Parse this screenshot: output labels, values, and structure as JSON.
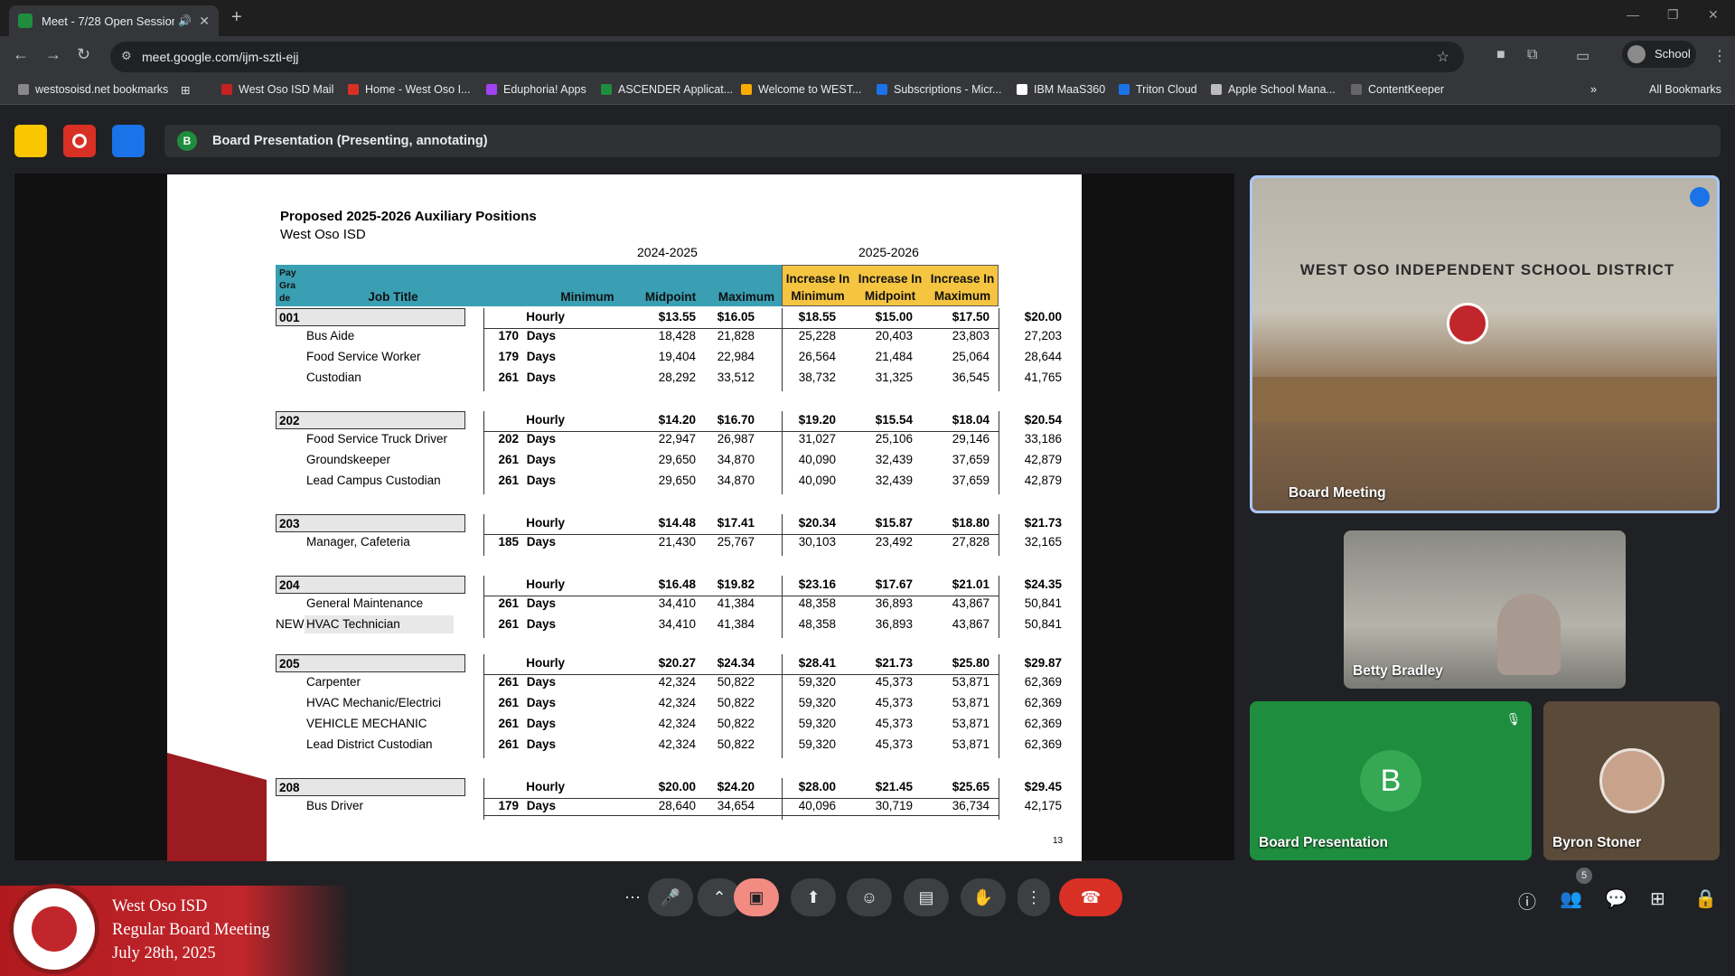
{
  "browser": {
    "tab_title": "Meet - 7/28 Open Session I",
    "url": "meet.google.com/ijm-szti-ejj",
    "profile": "School",
    "bookmarks": [
      "westosoisd.net bookmarks",
      "West Oso ISD Mail",
      "Home - West Oso I...",
      "Eduphoria! Apps",
      "ASCENDER Applicat...",
      "Welcome to WEST...",
      "Subscriptions - Micr...",
      "IBM MaaS360",
      "Triton Cloud",
      "Apple School Mana...",
      "ContentKeeper"
    ],
    "all_bookmarks": "All Bookmarks"
  },
  "meet": {
    "banner_initial": "B",
    "banner_text": "Board Presentation (Presenting, annotating)",
    "participants": [
      {
        "name": "Board Meeting"
      },
      {
        "name": "Betty Bradley"
      },
      {
        "name": "Board Presentation",
        "initial": "B"
      },
      {
        "name": "Byron Stoner"
      }
    ],
    "people_count": "5",
    "room_sign": "WEST OSO INDEPENDENT SCHOOL DISTRICT"
  },
  "slide": {
    "title": "Proposed 2025-2026 Auxiliary Positions",
    "subtitle": "West Oso ISD",
    "year_a": "2024-2025",
    "year_b": "2025-2026",
    "headers": {
      "pay_grade": "Pay\nGra\nde",
      "job_title": "Job Title",
      "min": "Minimum",
      "mid": "Midpoint",
      "max": "Maximum",
      "inc_min": "Increase In\nMinimum",
      "inc_mid": "Increase In\nMidpoint",
      "inc_max": "Increase In\nMaximum"
    },
    "page_number": "13",
    "groups": [
      {
        "grade": "001",
        "hourly": [
          "Hourly",
          "$13.55",
          "$16.05",
          "$18.55",
          "$15.00",
          "$17.50",
          "$20.00"
        ],
        "rows": [
          {
            "prefix": "",
            "title": "Bus Aide",
            "days": "170",
            "unit": "Days",
            "vals": [
              "18,428",
              "21,828",
              "25,228",
              "20,403",
              "23,803",
              "27,203"
            ]
          },
          {
            "prefix": "",
            "title": "Food Service Worker",
            "days": "179",
            "unit": "Days",
            "vals": [
              "19,404",
              "22,984",
              "26,564",
              "21,484",
              "25,064",
              "28,644"
            ]
          },
          {
            "prefix": "",
            "title": "Custodian",
            "days": "261",
            "unit": "Days",
            "vals": [
              "28,292",
              "33,512",
              "38,732",
              "31,325",
              "36,545",
              "41,765"
            ]
          }
        ]
      },
      {
        "grade": "202",
        "hourly": [
          "Hourly",
          "$14.20",
          "$16.70",
          "$19.20",
          "$15.54",
          "$18.04",
          "$20.54"
        ],
        "rows": [
          {
            "prefix": "",
            "title": "Food Service Truck Driver",
            "days": "202",
            "unit": "Days",
            "vals": [
              "22,947",
              "26,987",
              "31,027",
              "25,106",
              "29,146",
              "33,186"
            ]
          },
          {
            "prefix": "",
            "title": "Groundskeeper",
            "days": "261",
            "unit": "Days",
            "vals": [
              "29,650",
              "34,870",
              "40,090",
              "32,439",
              "37,659",
              "42,879"
            ]
          },
          {
            "prefix": "",
            "title": "Lead Campus Custodian",
            "days": "261",
            "unit": "Days",
            "vals": [
              "29,650",
              "34,870",
              "40,090",
              "32,439",
              "37,659",
              "42,879"
            ]
          }
        ]
      },
      {
        "grade": "203",
        "hourly": [
          "Hourly",
          "$14.48",
          "$17.41",
          "$20.34",
          "$15.87",
          "$18.80",
          "$21.73"
        ],
        "rows": [
          {
            "prefix": "",
            "title": "Manager, Cafeteria",
            "days": "185",
            "unit": "Days",
            "vals": [
              "21,430",
              "25,767",
              "30,103",
              "23,492",
              "27,828",
              "32,165"
            ]
          }
        ]
      },
      {
        "grade": "204",
        "hourly": [
          "Hourly",
          "$16.48",
          "$19.82",
          "$23.16",
          "$17.67",
          "$21.01",
          "$24.35"
        ],
        "rows": [
          {
            "prefix": "",
            "title": "General Maintenance",
            "days": "261",
            "unit": "Days",
            "vals": [
              "34,410",
              "41,384",
              "48,358",
              "36,893",
              "43,867",
              "50,841"
            ]
          },
          {
            "prefix": "NEW",
            "title": "HVAC Technician",
            "days": "261",
            "unit": "Days",
            "vals": [
              "34,410",
              "41,384",
              "48,358",
              "36,893",
              "43,867",
              "50,841"
            ]
          }
        ]
      },
      {
        "grade": "205",
        "hourly": [
          "Hourly",
          "$20.27",
          "$24.34",
          "$28.41",
          "$21.73",
          "$25.80",
          "$29.87"
        ],
        "rows": [
          {
            "prefix": "",
            "title": "Carpenter",
            "days": "261",
            "unit": "Days",
            "vals": [
              "42,324",
              "50,822",
              "59,320",
              "45,373",
              "53,871",
              "62,369"
            ]
          },
          {
            "prefix": "",
            "title": "HVAC Mechanic/Electrici",
            "days": "261",
            "unit": "Days",
            "vals": [
              "42,324",
              "50,822",
              "59,320",
              "45,373",
              "53,871",
              "62,369"
            ]
          },
          {
            "prefix": "",
            "title": "VEHICLE MECHANIC",
            "days": "261",
            "unit": "Days",
            "vals": [
              "42,324",
              "50,822",
              "59,320",
              "45,373",
              "53,871",
              "62,369"
            ]
          },
          {
            "prefix": "",
            "title": "Lead District Custodian",
            "days": "261",
            "unit": "Days",
            "vals": [
              "42,324",
              "50,822",
              "59,320",
              "45,373",
              "53,871",
              "62,369"
            ]
          }
        ]
      },
      {
        "grade": "208",
        "hourly": [
          "Hourly",
          "$20.00",
          "$24.20",
          "$28.00",
          "$21.45",
          "$25.65",
          "$29.45"
        ],
        "rows": [
          {
            "prefix": "",
            "title": "Bus Driver",
            "days": "179",
            "unit": "Days",
            "vals": [
              "28,640",
              "34,654",
              "40,096",
              "30,719",
              "36,734",
              "42,175"
            ]
          }
        ]
      }
    ]
  },
  "lower_third": {
    "line1": "West Oso ISD",
    "line2": "Regular Board Meeting",
    "line3": "July 28th, 2025"
  },
  "colors": {
    "teal": "#3a9fb3",
    "yellow": "#f5c542",
    "meet_bg": "#202124",
    "red": "#d93025"
  }
}
